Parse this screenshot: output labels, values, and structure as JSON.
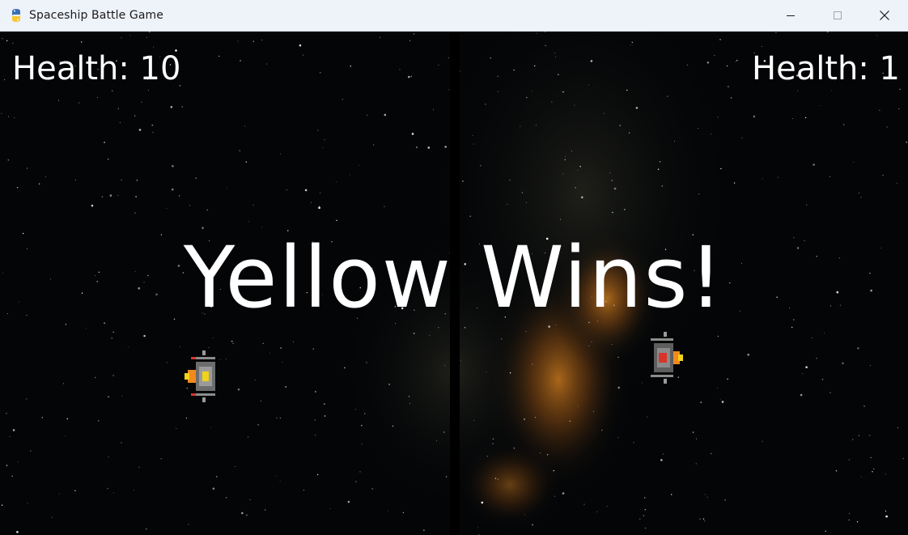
{
  "window": {
    "title": "Spaceship Battle Game",
    "app_icon": "python-snake-icon",
    "controls": [
      "minimize-icon",
      "maximize-icon",
      "close-icon"
    ]
  },
  "game": {
    "left_health_label": "Health: 10",
    "right_health_label": "Health: 1",
    "win_message": "Yellow Wins!",
    "yellow_health": 10,
    "red_health": 1,
    "colors": {
      "background": "#030507",
      "text": "#ffffff",
      "divider": "#000000",
      "yellow_ship_accent": "#f2d21a",
      "red_ship_accent": "#d8342a",
      "flame": "#f08a1c"
    }
  }
}
